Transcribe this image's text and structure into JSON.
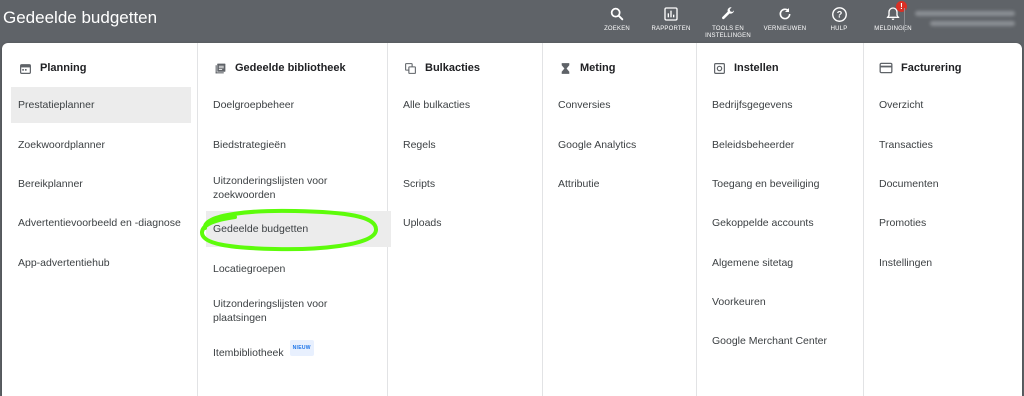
{
  "header": {
    "page_title": "Gedeelde budgetten",
    "tools": [
      {
        "label": "ZOEKEN",
        "icon": "search-icon"
      },
      {
        "label": "RAPPORTEN",
        "icon": "reports-icon"
      },
      {
        "label": "TOOLS EN INSTELLINGEN",
        "icon": "wrench-icon"
      },
      {
        "label": "VERNIEUWEN",
        "icon": "refresh-icon"
      },
      {
        "label": "HULP",
        "icon": "help-icon"
      },
      {
        "label": "MELDINGEN",
        "icon": "bell-icon",
        "badge": "!"
      }
    ]
  },
  "menu": {
    "columns": [
      {
        "title": "Planning",
        "icon": "calendar-icon",
        "items": [
          "Prestatieplanner",
          "Zoekwoordplanner",
          "Bereikplanner",
          "Advertentievoorbeeld en -diagnose",
          "App-advertentiehub"
        ],
        "selected": "Prestatieplanner"
      },
      {
        "title": "Gedeelde bibliotheek",
        "icon": "library-icon",
        "items": [
          "Doelgroepbeheer",
          "Biedstrategieën",
          "Uitzonderingslijsten voor zoekwoorden",
          "Gedeelde budgetten",
          "Locatiegroepen",
          "Uitzonderingslijsten voor plaatsingen",
          "Itembibliotheek"
        ],
        "selected": "Gedeelde budgetten",
        "highlighted": "Gedeelde budgetten",
        "badge": {
          "item": "Itembibliotheek",
          "text": "NIEUW"
        }
      },
      {
        "title": "Bulkacties",
        "icon": "copy-icon",
        "items": [
          "Alle bulkacties",
          "Regels",
          "Scripts",
          "Uploads"
        ]
      },
      {
        "title": "Meting",
        "icon": "hourglass-icon",
        "items": [
          "Conversies",
          "Google Analytics",
          "Attributie"
        ]
      },
      {
        "title": "Instellen",
        "icon": "settings-icon",
        "items": [
          "Bedrijfsgegevens",
          "Beleidsbeheerder",
          "Toegang en beveiliging",
          "Gekoppelde accounts",
          "Algemene sitetag",
          "Voorkeuren",
          "Google Merchant Center"
        ]
      },
      {
        "title": "Facturering",
        "icon": "credit-card-icon",
        "items": [
          "Overzicht",
          "Transacties",
          "Documenten",
          "Promoties",
          "Instellingen"
        ]
      }
    ]
  },
  "colors": {
    "header_bg": "#5f6368",
    "panel_bg": "#ffffff",
    "selected_bg": "#ececec",
    "highlight_ring": "#5dfc0a",
    "badge_text": "#1a73e8",
    "notification": "#d93025"
  }
}
